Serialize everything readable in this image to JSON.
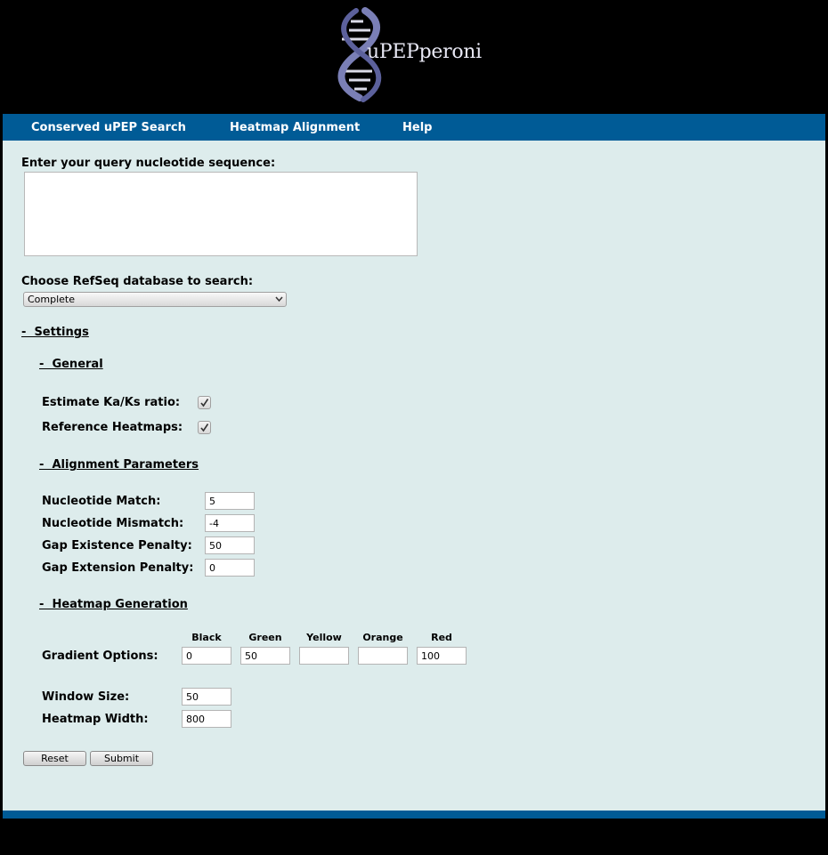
{
  "header": {
    "logo_text": "uPEPperoni"
  },
  "nav": {
    "items": [
      {
        "label": "Conserved uPEP Search"
      },
      {
        "label": "Heatmap Alignment"
      },
      {
        "label": "Help"
      }
    ]
  },
  "form": {
    "query_label": "Enter your query nucleotide sequence:",
    "query_value": "",
    "db_label": "Choose RefSeq database to search:",
    "db_selected": "Complete",
    "settings_toggle": "-  Settings",
    "general_toggle": "-  General",
    "kaks_label": "Estimate Ka/Ks ratio:",
    "kaks_checked": true,
    "refheat_label": "Reference Heatmaps:",
    "refheat_checked": true,
    "alignment_toggle": "-  Alignment Parameters",
    "match_label": "Nucleotide Match:",
    "match_value": "5",
    "mismatch_label": "Nucleotide Mismatch:",
    "mismatch_value": "-4",
    "gap_exist_label": "Gap Existence Penalty:",
    "gap_exist_value": "50",
    "gap_ext_label": "Gap Extension Penalty:",
    "gap_ext_value": "0",
    "heatmap_toggle": "-  Heatmap Generation",
    "gradient_label": "Gradient Options:",
    "gradient_columns": [
      {
        "name": "Black",
        "value": "0"
      },
      {
        "name": "Green",
        "value": "50"
      },
      {
        "name": "Yellow",
        "value": ""
      },
      {
        "name": "Orange",
        "value": ""
      },
      {
        "name": "Red",
        "value": "100"
      }
    ],
    "window_label": "Window Size:",
    "window_value": "50",
    "width_label": "Heatmap Width:",
    "width_value": "800",
    "reset_label": "Reset",
    "submit_label": "Submit"
  },
  "colors": {
    "nav_bg": "#005b96",
    "content_bg": "#ddecec",
    "page_bg": "#000000"
  },
  "icons": {
    "logo": "dna-helix-icon",
    "checkbox": "checkmark-icon",
    "select": "chevron-down-icon"
  }
}
